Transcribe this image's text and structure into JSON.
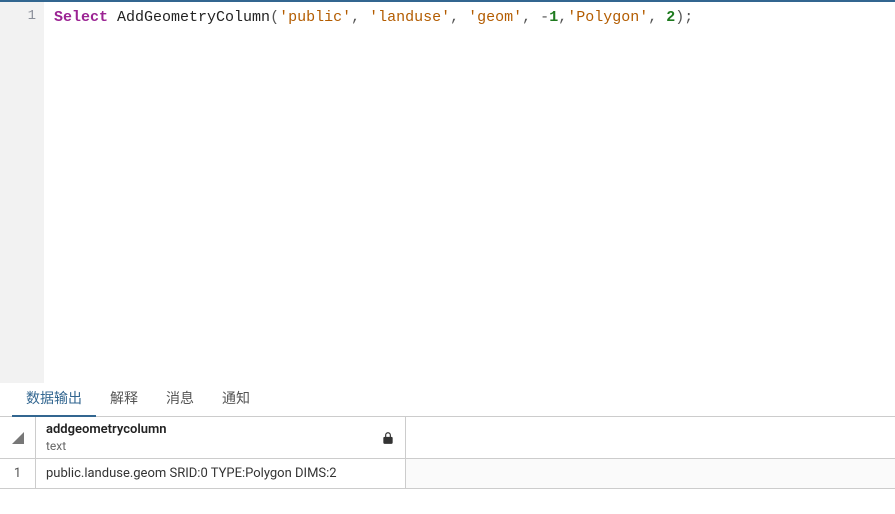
{
  "editor": {
    "line_number": "1",
    "code": {
      "keyword": "Select",
      "function": "AddGeometryColumn",
      "open_paren": "(",
      "arg1": "'public'",
      "comma1": ", ",
      "arg2": "'landuse'",
      "comma2": ", ",
      "arg3": "'geom'",
      "comma3": ", ",
      "arg4_sign": "-",
      "arg4_num": "1",
      "comma4": ",",
      "arg5": "'Polygon'",
      "comma5": ", ",
      "arg6": "2",
      "close": ");"
    }
  },
  "tabs": {
    "data_output": "数据输出",
    "explain": "解释",
    "messages": "消息",
    "notifications": "通知"
  },
  "grid": {
    "column": {
      "name": "addgeometrycolumn",
      "type": "text",
      "lock_icon": "lock-icon"
    },
    "row": {
      "number": "1",
      "value": "public.landuse.geom SRID:0 TYPE:Polygon DIMS:2"
    }
  }
}
